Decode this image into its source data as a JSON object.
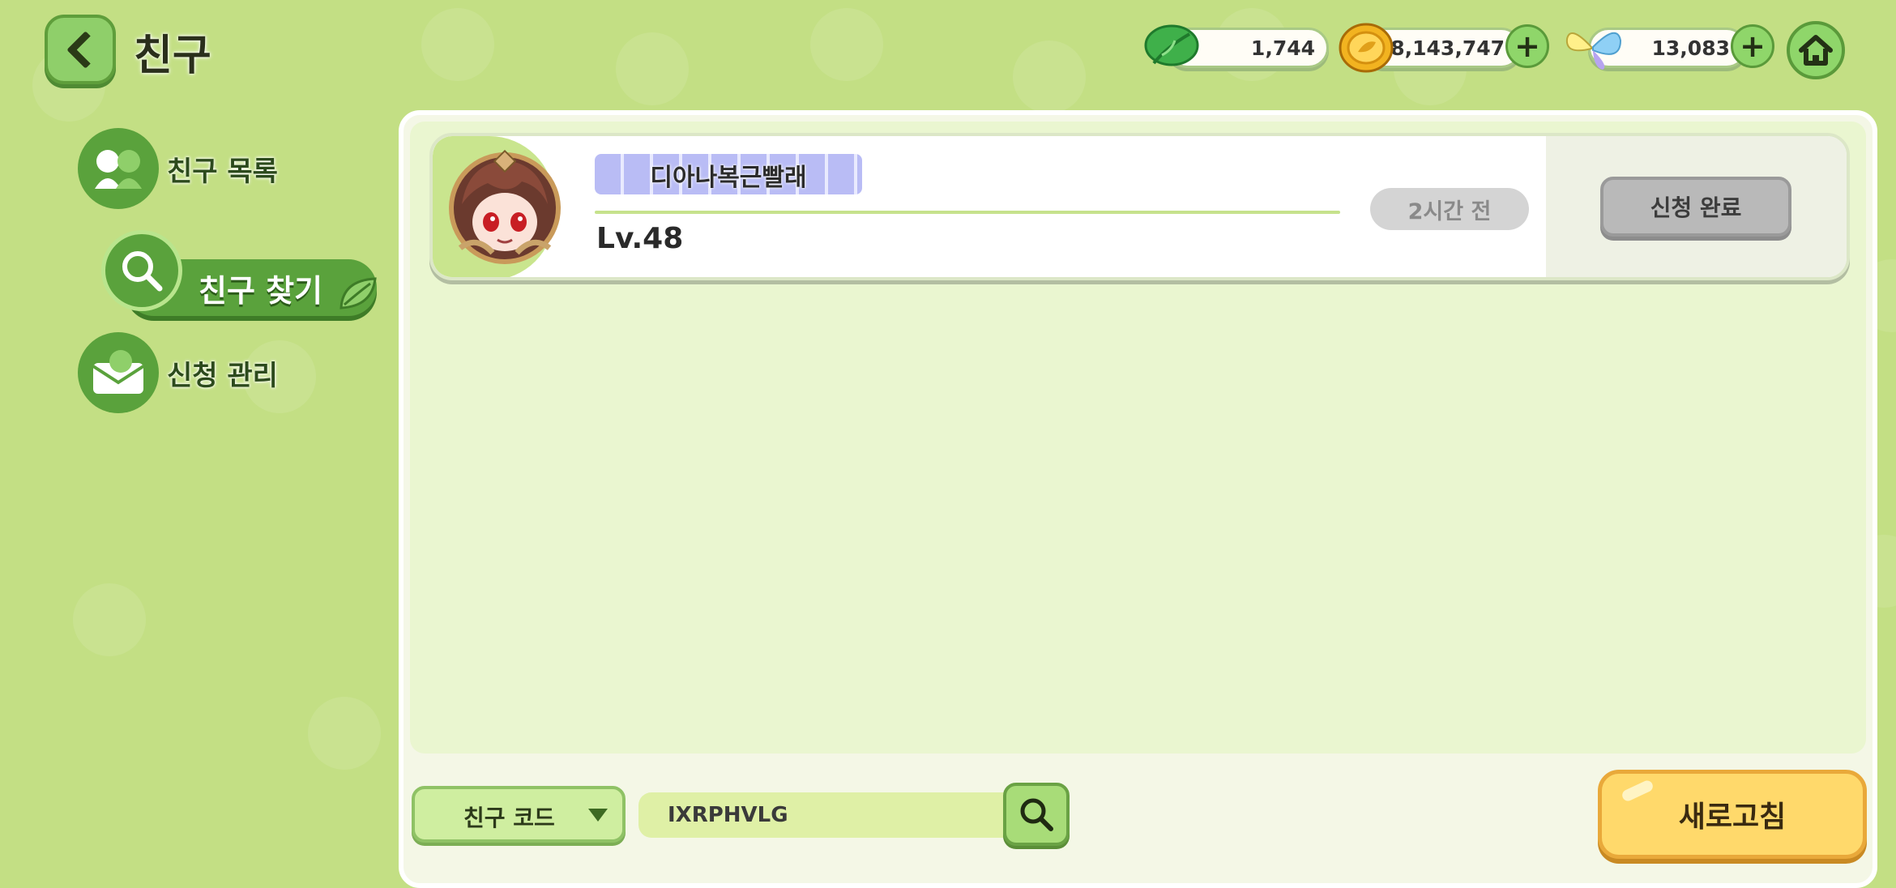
{
  "header": {
    "title": "친구",
    "currencies": [
      {
        "icon": "leaf-stamina-icon",
        "value": "1,744",
        "has_plus": false
      },
      {
        "icon": "gold-coin-icon",
        "value": "18,143,747",
        "has_plus": true
      },
      {
        "icon": "butterfly-gem-icon",
        "value": "13,083",
        "has_plus": true
      }
    ]
  },
  "sidebar": {
    "items": [
      {
        "label": "친구 목록",
        "icon": "friends-list-icon",
        "active": false
      },
      {
        "label": "친구 찾기",
        "icon": "search-icon",
        "active": true
      },
      {
        "label": "신청 관리",
        "icon": "request-manage-icon",
        "active": false
      }
    ]
  },
  "friend_card": {
    "name": "디아나복근빨래",
    "level": "Lv.48",
    "last_seen": "2시간 전",
    "action_label": "신청 완료"
  },
  "bottom_bar": {
    "search_type": "친구 코드",
    "search_value": "IXRPHVLG",
    "refresh_label": "새로고침"
  },
  "colors": {
    "background": "#c3df84",
    "accent_green": "#5aa23c",
    "refresh_yellow": "#ffd96b"
  }
}
